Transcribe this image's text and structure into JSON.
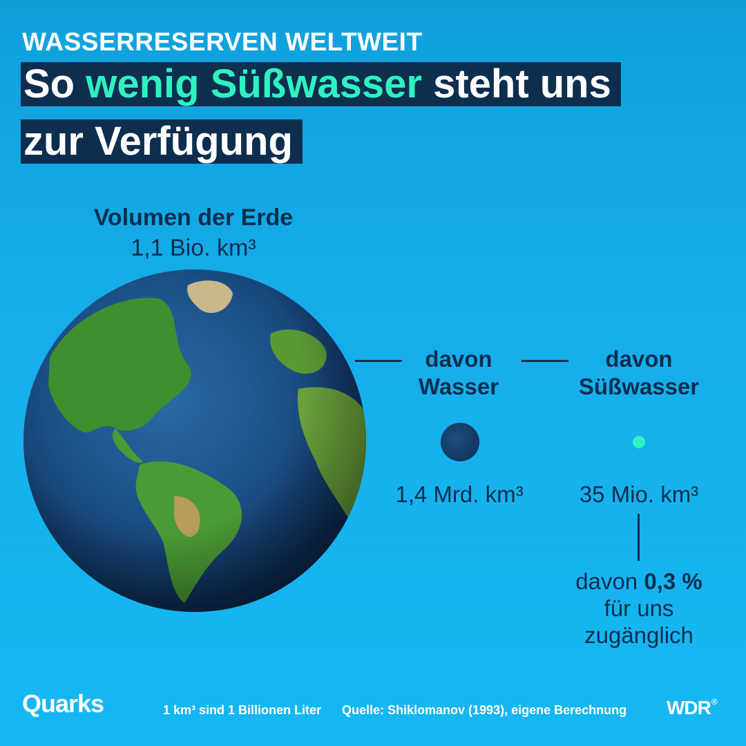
{
  "kicker": "WASSERRESERVEN WELTWEIT",
  "headline": {
    "part1": "So ",
    "highlight": "wenig Süßwasser",
    "part2": " steht uns",
    "line2": "zur Verfügung"
  },
  "earth": {
    "title": "Volumen der Erde",
    "value": "1,1 Bio. km³"
  },
  "water": {
    "label_line1": "davon",
    "label_line2": "Wasser",
    "value": "1,4 Mrd. km³"
  },
  "freshwater": {
    "label_line1": "davon",
    "label_line2": "Süßwasser",
    "value": "35 Mio. km³"
  },
  "accessible": {
    "prefix": "davon ",
    "percent": "0,3 %",
    "line2": "für uns",
    "line3": "zugänglich"
  },
  "footer": {
    "brand": "Quarks",
    "note": "1 km³ sind 1 Billionen Liter",
    "source": "Quelle:  Shiklomanov (1993), eigene Berechnung",
    "broadcaster": "WDR",
    "broadcaster_mark": "®"
  },
  "colors": {
    "background": "#15b0ee",
    "navy": "#0d2e4f",
    "accent": "#2ef2c0",
    "ocean": "#1b4f86",
    "land": "#3f8f2f"
  }
}
